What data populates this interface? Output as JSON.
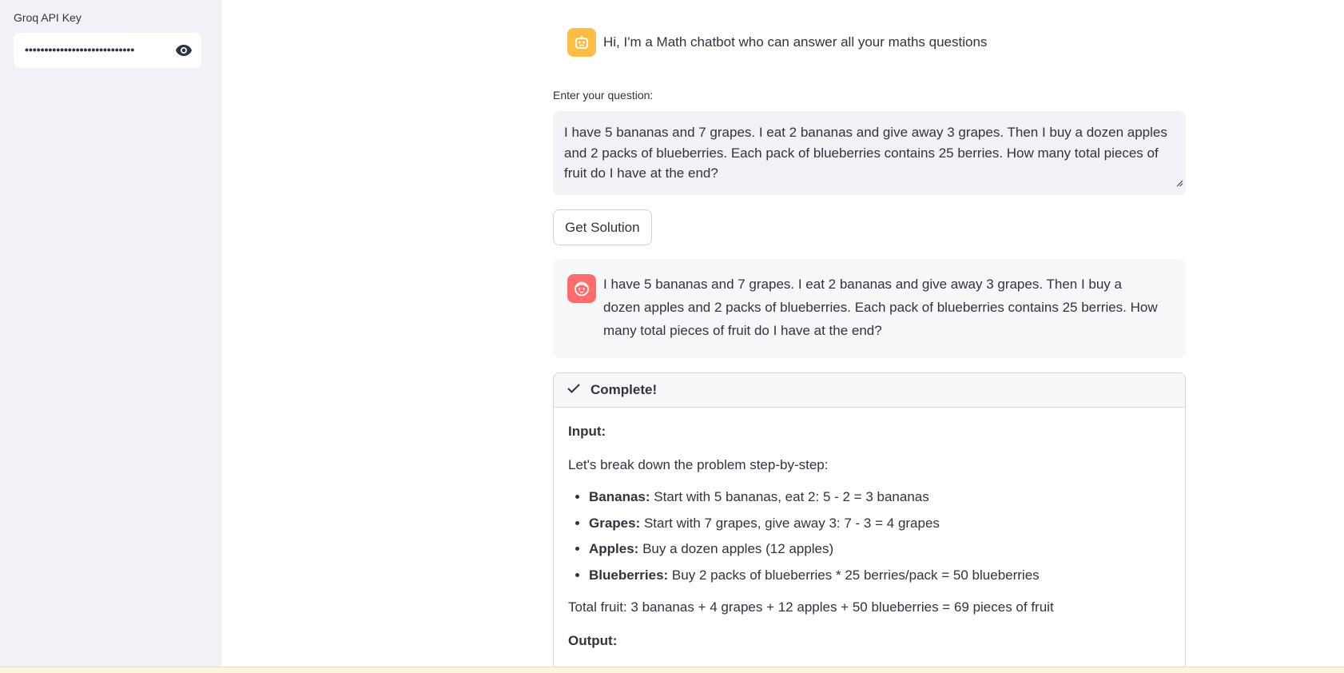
{
  "sidebar": {
    "api_key_label": "Groq API Key",
    "api_key_value": "••••••••••••••••••••••••••••"
  },
  "chat": {
    "bot_greeting": "Hi, I'm a Math chatbot who can answer all your maths questions",
    "question_label": "Enter your question:",
    "question_value": "I have 5 bananas and 7 grapes. I eat 2 bananas and give away 3 grapes. Then I buy a dozen apples and 2 packs of blueberries. Each pack of blueberries contains 25 berries. How many total pieces of fruit do I have at the end?",
    "submit_label": "Get Solution",
    "user_message": "I have 5 bananas and 7 grapes. I eat 2 bananas and give away 3 grapes. Then I buy a dozen apples and 2 packs of blueberries. Each pack of blueberries contains 25 berries. How many total pieces of fruit do I have at the end?"
  },
  "status": {
    "title": "Complete!",
    "input_label": "Input:",
    "intro": "Let's break down the problem step-by-step:",
    "steps": [
      {
        "name": "Bananas:",
        "text": " Start with 5 bananas, eat 2: 5 - 2 = 3 bananas"
      },
      {
        "name": "Grapes:",
        "text": " Start with 7 grapes, give away 3: 7 - 3 = 4 grapes"
      },
      {
        "name": "Apples:",
        "text": " Buy a dozen apples (12 apples)"
      },
      {
        "name": "Blueberries:",
        "text": " Buy 2 packs of blueberries * 25 berries/pack = 50 blueberries"
      }
    ],
    "total": "Total fruit: 3 bananas + 4 grapes + 12 apples + 50 blueberries = 69 pieces of fruit",
    "output_label": "Output:"
  },
  "colors": {
    "bot_avatar": "#ffbd45",
    "user_avatar": "#ff6c6c",
    "sidebar_bg": "#f0f2f6"
  },
  "icons": {
    "eye": "eye-icon",
    "bot": "robot-icon",
    "user": "user-face-icon",
    "check": "check-icon"
  }
}
